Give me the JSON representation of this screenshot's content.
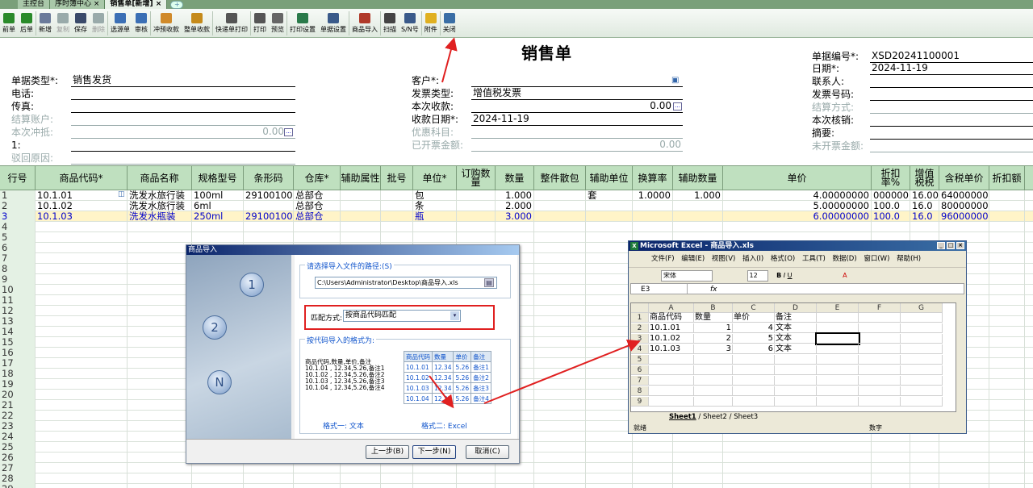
{
  "tabs": [
    {
      "label": "主控台"
    },
    {
      "label": "序时簿中心 ×"
    },
    {
      "label": "销售单[新增] ×"
    }
  ],
  "toolbar": [
    {
      "label": "前单",
      "icon": "arrow-left-icon",
      "color": "#2a8a2a",
      "enabled": true
    },
    {
      "label": "后单",
      "icon": "arrow-right-icon",
      "color": "#2a8a2a",
      "enabled": true
    },
    {
      "label": "新增",
      "icon": "new-doc-icon",
      "color": "#6a7a9a",
      "enabled": true
    },
    {
      "label": "复制",
      "icon": "copy-icon",
      "color": "#9aa",
      "enabled": false
    },
    {
      "label": "保存",
      "icon": "save-icon",
      "color": "#3a4a6a",
      "enabled": true
    },
    {
      "label": "删除",
      "icon": "delete-icon",
      "color": "#9aa",
      "enabled": false
    },
    {
      "label": "选源单",
      "icon": "select-source-icon",
      "color": "#3b6fb5",
      "enabled": true
    },
    {
      "label": "审核",
      "icon": "audit-icon",
      "color": "#3b6fb5",
      "enabled": true
    },
    {
      "label": "冲预收款",
      "icon": "offset-prepay-icon",
      "color": "#d08a2a",
      "enabled": true
    },
    {
      "label": "整单收款",
      "icon": "collect-icon",
      "color": "#c58a1a",
      "enabled": true
    },
    {
      "label": "快递单打印",
      "icon": "express-print-icon",
      "color": "#555",
      "enabled": true
    },
    {
      "label": "打印",
      "icon": "printer-icon",
      "color": "#555",
      "enabled": true
    },
    {
      "label": "预览",
      "icon": "preview-icon",
      "color": "#666",
      "enabled": true
    },
    {
      "label": "打印设置",
      "icon": "print-settings-icon",
      "color": "#2a7a4a",
      "enabled": true
    },
    {
      "label": "单据设置",
      "icon": "bill-settings-icon",
      "color": "#3a5a8a",
      "enabled": true
    },
    {
      "label": "商品导入",
      "icon": "import-icon",
      "color": "#b03a2a",
      "enabled": true
    },
    {
      "label": "扫描",
      "icon": "scan-icon",
      "color": "#444",
      "enabled": true
    },
    {
      "label": "S/N号",
      "icon": "serial-icon",
      "color": "#3a5a8a",
      "enabled": true
    },
    {
      "label": "附件",
      "icon": "folder-icon",
      "color": "#e0b020",
      "enabled": true
    },
    {
      "label": "关闭",
      "icon": "exit-icon",
      "color": "#3a6ea5",
      "enabled": true
    }
  ],
  "title": "销售单",
  "header": {
    "bill_type_label": "单据类型*:",
    "bill_type": "销售发货",
    "phone_label": "电话:",
    "phone": "",
    "fax_label": "传真:",
    "fax": "",
    "settle_acct_label": "结算账户:",
    "settle_acct": "",
    "offset_label": "本次冲抵:",
    "offset": "0.00",
    "one_label": "1:",
    "one": "",
    "reject_label": "驳回原因:",
    "reject": "",
    "customer_label": "客户*:",
    "customer": "",
    "invoice_type_label": "发票类型:",
    "invoice_type": "增值税发票",
    "this_received_label": "本次收款:",
    "this_received": "0.00",
    "receipt_date_label": "收款日期*:",
    "receipt_date": "2024-11-19",
    "discount_subject_label": "优惠科目:",
    "discount_subject": "",
    "invoiced_label": "已开票金额:",
    "invoiced": "0.00",
    "bill_no_label": "单据编号*:",
    "bill_no": "XSD20241100001",
    "date_label": "日期*:",
    "date": "2024-11-19",
    "contact_label": "联系人:",
    "contact": "",
    "invoice_no_label": "发票号码:",
    "invoice_no": "",
    "settle_method_label": "结算方式:",
    "settle_method": "",
    "this_writeoff_label": "本次核销:",
    "this_writeoff": "",
    "summary_label": "摘要:",
    "summary": "",
    "uninvoiced_label": "未开票金额:",
    "uninvoiced": ""
  },
  "grid": {
    "columns": [
      "行号",
      "商品代码*",
      "商品名称",
      "规格型号",
      "条形码",
      "仓库*",
      "辅助属性",
      "批号",
      "单位*",
      "订购数量",
      "数量",
      "整件散包",
      "辅助单位",
      "换算率",
      "辅助数量",
      "单价",
      "折扣率%",
      "增值税税",
      "含税单价",
      "折扣额"
    ],
    "rows": [
      {
        "no": "1",
        "code": "10.1.01",
        "name": "洗发水旅行装",
        "spec": "100ml",
        "barcode": "291001000",
        "warehouse": "总部仓",
        "unit": "包",
        "qty": "1.000",
        "aux_unit": "套",
        "rate": "1.0000",
        "aux_qty": "1.000",
        "price": "4.00000000",
        "disc": "000000",
        "tax": "16.00",
        "tax_price": "64000000"
      },
      {
        "no": "2",
        "code": "10.1.02",
        "name": "洗发水旅行装",
        "spec": "6ml",
        "barcode": "",
        "warehouse": "总部仓",
        "unit": "条",
        "qty": "2.000",
        "aux_unit": "",
        "rate": "",
        "aux_qty": "",
        "price": "5.00000000",
        "disc": "100.0",
        "tax": "16.0",
        "tax_price": "80000000"
      },
      {
        "no": "3",
        "code": "10.1.03",
        "name": "洗发水瓶装",
        "spec": "250ml",
        "barcode": "291001000",
        "warehouse": "总部仓",
        "unit": "瓶",
        "qty": "3.000",
        "aux_unit": "",
        "rate": "",
        "aux_qty": "",
        "price": "6.00000000",
        "disc": "100.0",
        "tax": "16.0",
        "tax_price": "96000000"
      }
    ],
    "empty_rows": [
      "4",
      "5",
      "6",
      "7",
      "8",
      "9",
      "10",
      "11",
      "12",
      "13",
      "14",
      "15",
      "16",
      "17",
      "18",
      "19",
      "20",
      "21",
      "22",
      "23",
      "24",
      "25",
      "26",
      "27",
      "28",
      "29"
    ]
  },
  "dialog": {
    "title": "商品导入",
    "path_group": "请选择导入文件的路径:(S)",
    "path_value": "C:\\Users\\Administrator\\Desktop\\商品导入.xls",
    "match_label": "匹配方式:",
    "match_value": "按商品代码匹配",
    "format_group": "按代码导入的格式为:",
    "format_text_lines": [
      "商品代码,数量,单价,备注",
      "10.1.01 , 12.34,5.26,备注1",
      "10.1.02 , 12.34,5.26,备注2",
      "10.1.03 , 12.34,5.26,备注3",
      "10.1.04 , 12.34,5.26,备注4"
    ],
    "sample_headers": [
      "商品代码",
      "数量",
      "单价",
      "备注"
    ],
    "sample_rows": [
      [
        "10.1.01",
        "12.34",
        "5.26",
        "备注1"
      ],
      [
        "10.1.02",
        "12.34",
        "5.26",
        "备注2"
      ],
      [
        "10.1.03",
        "12.34",
        "5.26",
        "备注3"
      ],
      [
        "10.1.04",
        "12.34",
        "5.26",
        "备注4"
      ]
    ],
    "format1": "格式一: 文本",
    "format2": "格式二: Excel",
    "steps": [
      "1",
      "2",
      "N"
    ],
    "prev": "上一步(B)",
    "next": "下一步(N)",
    "cancel": "取消(C)"
  },
  "excel": {
    "title": "Microsoft Excel - 商品导入.xls",
    "menu": "文件(F) 编辑(E) 视图(V) 插入(I) 格式(O) 工具(T) 数据(D) 窗口(W) 帮助(H)",
    "font": "宋体",
    "size": "12",
    "namebox": "E3",
    "fx": "fx",
    "col_headers": [
      "A",
      "B",
      "C",
      "D",
      "E",
      "F",
      "G"
    ],
    "row_headers": [
      "1",
      "2",
      "3",
      "4",
      "5",
      "6",
      "7",
      "8",
      "9"
    ],
    "cells": [
      [
        "商品代码",
        "数量",
        "单价",
        "备注"
      ],
      [
        "10.1.01",
        "1",
        "4",
        "文本"
      ],
      [
        "10.1.02",
        "2",
        "5",
        "文本"
      ],
      [
        "10.1.03",
        "3",
        "6",
        "文本"
      ]
    ],
    "sheets": [
      "Sheet1",
      "Sheet2",
      "Sheet3"
    ],
    "status_left": "就绪",
    "status_right": "数字"
  }
}
